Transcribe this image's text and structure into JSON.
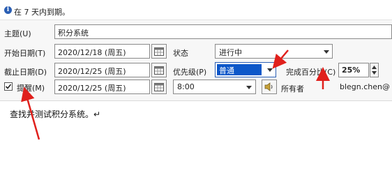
{
  "info": {
    "text": "在 7 天内到期。"
  },
  "form": {
    "subject_label": "主题(U)",
    "subject_value": "积分系统",
    "start_label": "开始日期(T)",
    "start_value": "2020/12/18 (周五)",
    "due_label": "截止日期(D)",
    "due_value": "2020/12/25 (周五)",
    "status_label": "状态",
    "status_value": "进行中",
    "priority_label": "优先级(P)",
    "priority_value": "普通",
    "percent_label": "完成百分比(C)",
    "percent_value": "25%",
    "reminder_label": "提醒(M)",
    "reminder_checked": true,
    "reminder_date": "2020/12/25 (周五)",
    "reminder_time": "8:00",
    "owner_label": "所有者",
    "owner_value": "blegn.chen@"
  },
  "body": {
    "text": "查找并测试积分系统。↵"
  },
  "colors": {
    "accent_blue": "#2b5fb4",
    "annotation_red": "#e0201c",
    "priority_highlight": "#0c57c9"
  }
}
